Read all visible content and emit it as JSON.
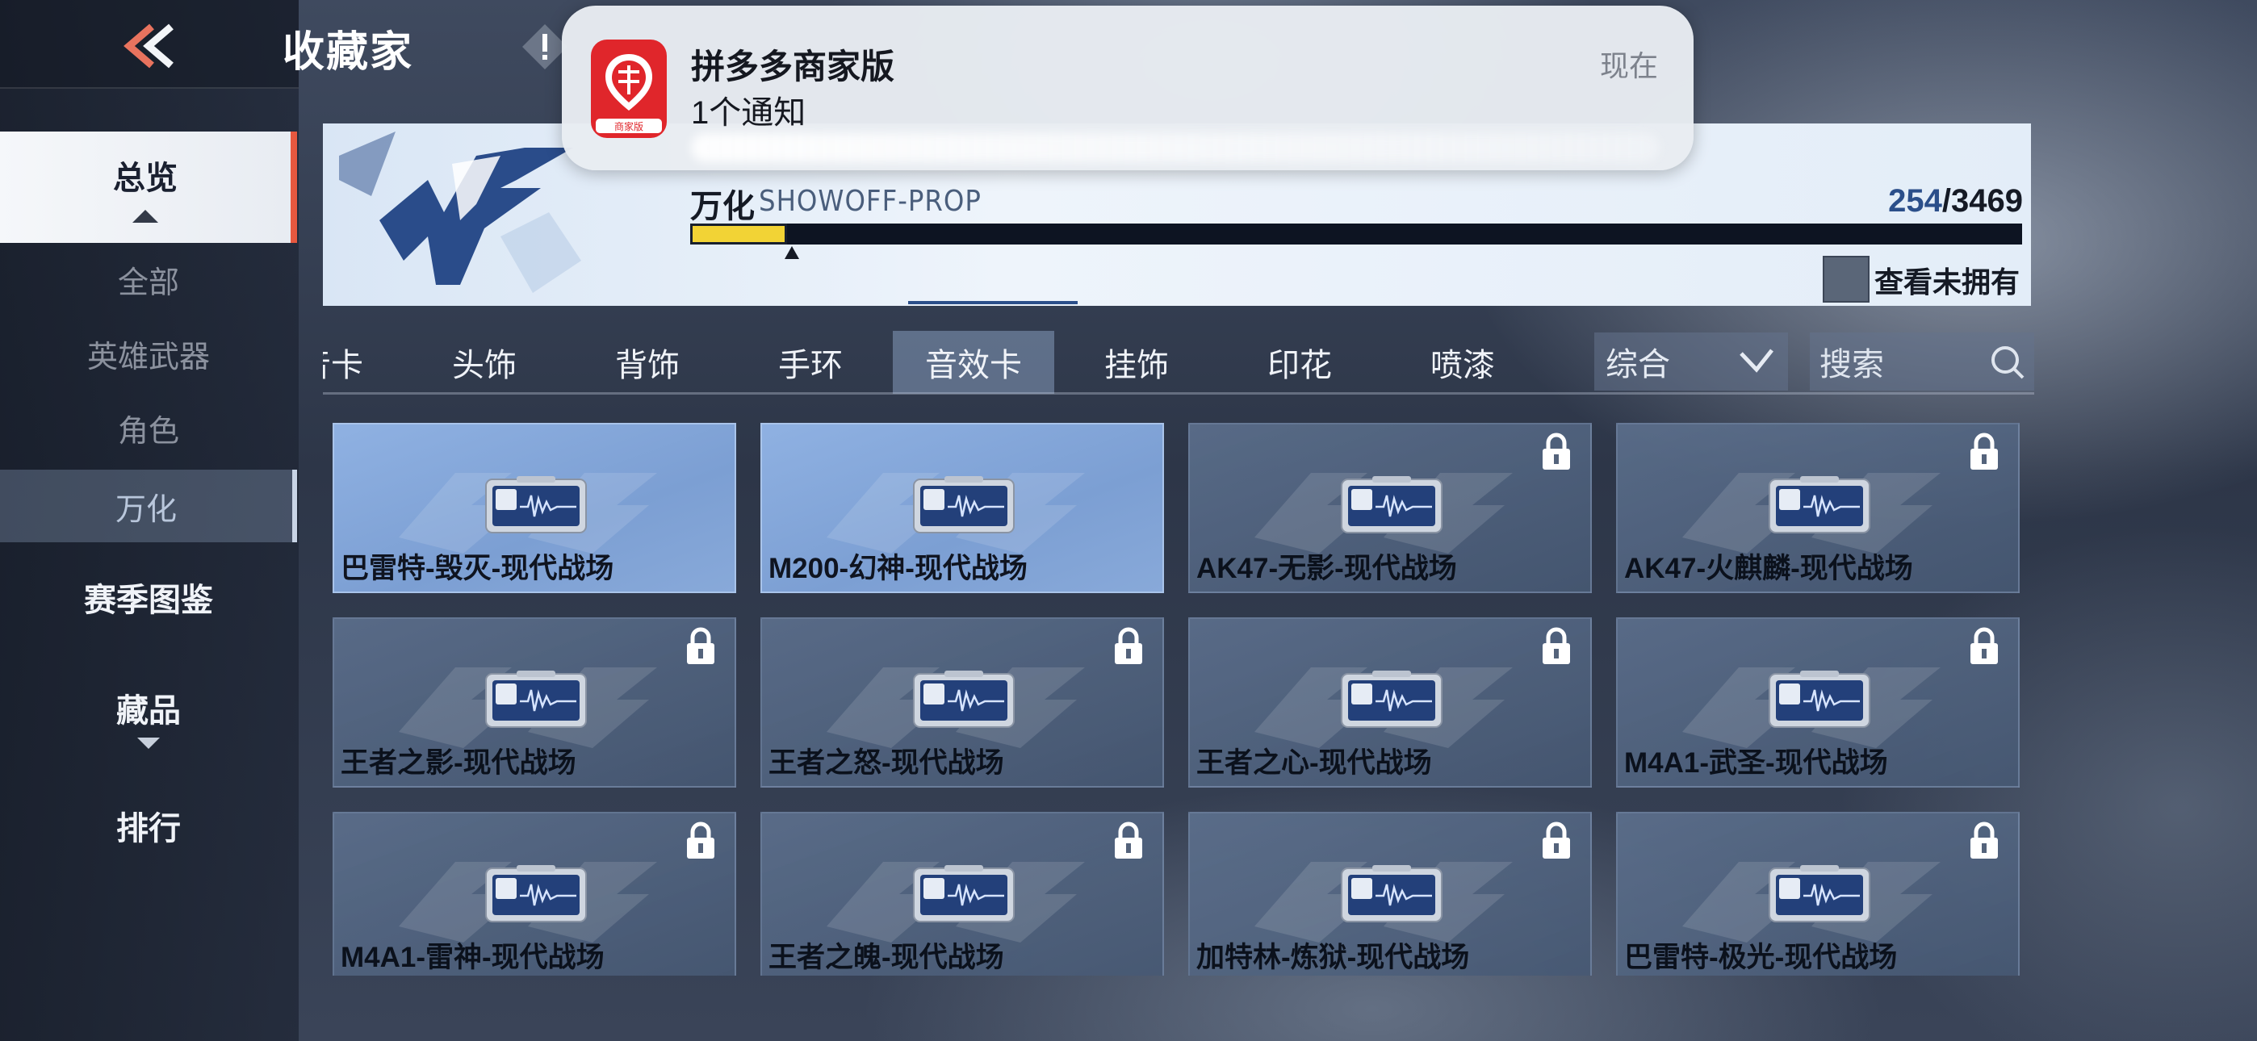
{
  "header": {
    "title": "收藏家"
  },
  "sidebar": {
    "overview": "总览",
    "sub_items": [
      "全部",
      "英雄武器",
      "角色",
      "万化"
    ],
    "active_sub": "万化",
    "main_items": [
      "赛季图鉴",
      "藏品",
      "排行"
    ]
  },
  "banner": {
    "series_name": "万化",
    "series_code": "SHOWOFF-PROP",
    "owned": "254",
    "separator": "/",
    "total": "3469",
    "progress_fraction": 0.073,
    "unowned_toggle_label": "查看未拥有"
  },
  "tabs": {
    "items": [
      "音卡",
      "头饰",
      "背饰",
      "手环",
      "音效卡",
      "挂饰",
      "印花",
      "喷漆"
    ],
    "active": "音效卡",
    "sort_label": "综合",
    "search_placeholder": "搜索"
  },
  "grid": {
    "items": [
      {
        "name": "巴雷特-毁灭-现代战场",
        "locked": false
      },
      {
        "name": "M200-幻神-现代战场",
        "locked": false
      },
      {
        "name": "AK47-无影-现代战场",
        "locked": true
      },
      {
        "name": "AK47-火麒麟-现代战场",
        "locked": true
      },
      {
        "name": "王者之影-现代战场",
        "locked": true
      },
      {
        "name": "王者之怒-现代战场",
        "locked": true
      },
      {
        "name": "王者之心-现代战场",
        "locked": true
      },
      {
        "name": "M4A1-武圣-现代战场",
        "locked": true
      },
      {
        "name": "M4A1-雷神-现代战场",
        "locked": true
      },
      {
        "name": "王者之魄-现代战场",
        "locked": true
      },
      {
        "name": "加特林-炼狱-现代战场",
        "locked": true
      },
      {
        "name": "巴雷特-极光-现代战场",
        "locked": true
      }
    ]
  },
  "notification": {
    "app_name": "拼多多商家版",
    "icon_caption": "商家版",
    "body": "1个通知",
    "time": "现在"
  },
  "colors": {
    "accent_red": "#e7583f",
    "progress_yellow": "#f2d335",
    "owned_card": "#8fb1e2",
    "locked_card": "#5f7391",
    "pdd_red": "#e0262b"
  }
}
